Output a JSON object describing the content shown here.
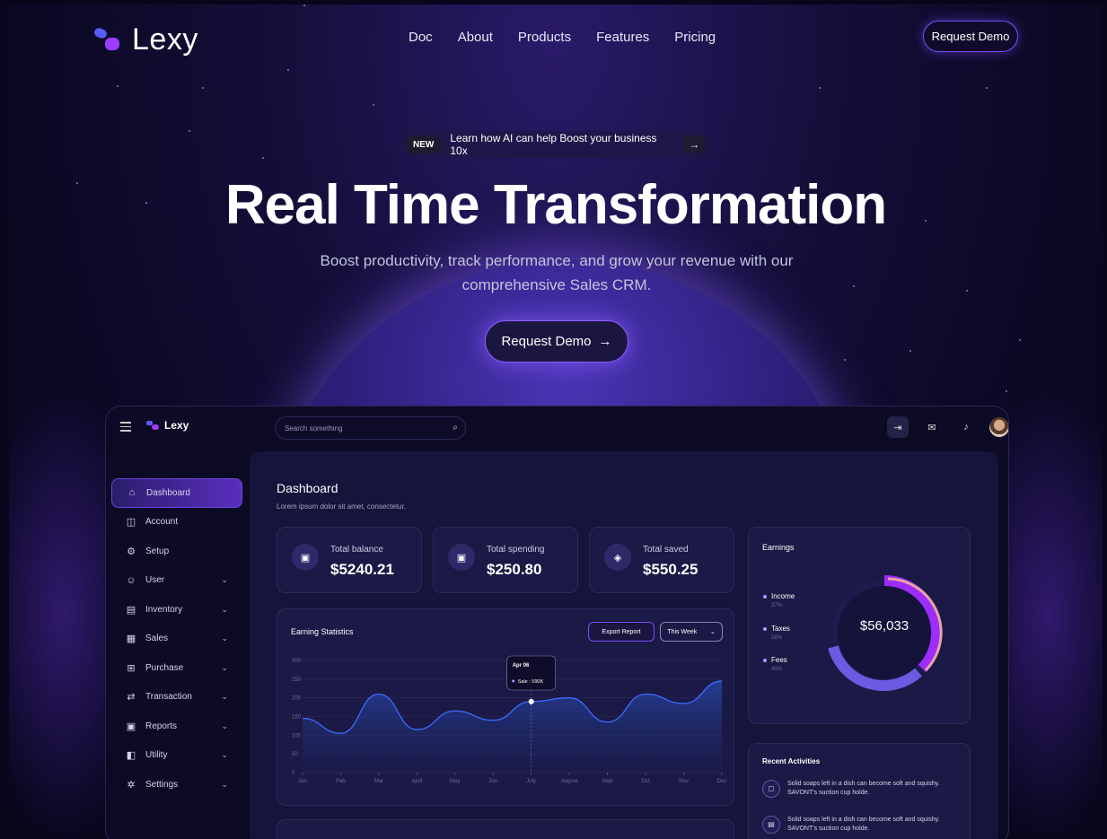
{
  "brand": {
    "name": "Lexy"
  },
  "nav": [
    "Doc",
    "About",
    "Products",
    "Features",
    "Pricing"
  ],
  "top_cta": "Request Demo",
  "announcement": {
    "badge": "NEW",
    "text": "Learn how AI can help Boost your business 10x",
    "arrow": "→"
  },
  "hero": {
    "title": "Real Time Transformation",
    "subtitle": "Boost productivity, track performance, and grow your revenue with our comprehensive Sales CRM.",
    "cta": "Request Demo",
    "cta_arrow": "→"
  },
  "dashboard": {
    "logo": "Lexy",
    "search_placeholder": "Search something",
    "sidebar": [
      {
        "label": "Dashboard",
        "icon": "⌂",
        "chev": ""
      },
      {
        "label": "Account",
        "icon": "◫",
        "chev": ""
      },
      {
        "label": "Setup",
        "icon": "⚙",
        "chev": ""
      },
      {
        "label": "User",
        "icon": "☺",
        "chev": "⌄"
      },
      {
        "label": "Inventory",
        "icon": "▤",
        "chev": "⌄"
      },
      {
        "label": "Sales",
        "icon": "▦",
        "chev": "⌄"
      },
      {
        "label": "Purchase",
        "icon": "⊞",
        "chev": "⌄"
      },
      {
        "label": "Transaction",
        "icon": "⇄",
        "chev": "⌄"
      },
      {
        "label": "Reports",
        "icon": "▣",
        "chev": "⌄"
      },
      {
        "label": "Utility",
        "icon": "◧",
        "chev": "⌄"
      },
      {
        "label": "Settings",
        "icon": "✲",
        "chev": "⌄"
      }
    ],
    "title": "Dashboard",
    "subtitle": "Lorem ipsum dolor sit amet, consectetur.",
    "stats": [
      {
        "label": "Total balance",
        "value": "$5240.21",
        "icon": "▣"
      },
      {
        "label": "Total spending",
        "value": "$250.80",
        "icon": "▣"
      },
      {
        "label": "Total saved",
        "value": "$550.25",
        "icon": "◈"
      }
    ],
    "earning_stats": {
      "title": "Earning Statistics",
      "export_label": "Export Report",
      "period": "This Week",
      "tooltip_date": "Apr 06",
      "tooltip_value": "Sale : 590K"
    },
    "earnings": {
      "title": "Earnings",
      "total": "$56,033",
      "legend": [
        {
          "name": "Income",
          "pct": "37%"
        },
        {
          "name": "Taxes",
          "pct": "28%"
        },
        {
          "name": "Fees",
          "pct": "40%"
        }
      ]
    },
    "recent": {
      "title": "Recent Activities",
      "items": [
        "Solid soaps left in a dish can become soft and squishy. SAVONT's suction cup holde.",
        "Solid soaps left in a dish can become soft and squishy. SAVONT's suction cup holde."
      ]
    }
  },
  "chart_data": {
    "type": "area",
    "x": [
      "Jan",
      "Feb",
      "Mar",
      "April",
      "May",
      "Jun",
      "July",
      "August",
      "Sept",
      "Oct",
      "Nov",
      "Dec"
    ],
    "series": [
      {
        "values": [
          145,
          105,
          210,
          115,
          165,
          140,
          190,
          200,
          135,
          210,
          185,
          245
        ]
      }
    ],
    "yticks": [
      0,
      50,
      100,
      150,
      200,
      250,
      300
    ],
    "ylim": [
      0,
      300
    ],
    "grid": true
  }
}
